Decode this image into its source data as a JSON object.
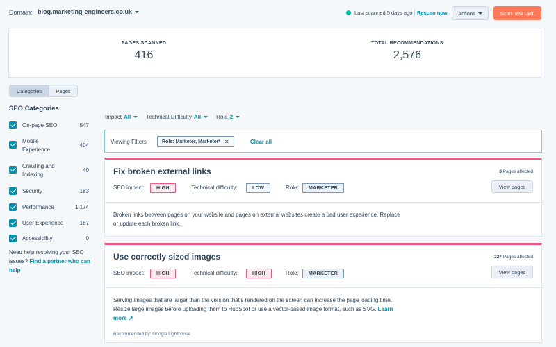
{
  "header": {
    "domain_label": "Domain:",
    "domain_value": "blog.marketing-engineers.co.uk",
    "last_scanned": "Last scanned 5 days ago",
    "rescan": "Rescan now",
    "actions": "Actions",
    "scan_new": "Scan new URL",
    "status_color": "#00bda5"
  },
  "stats": [
    {
      "label": "PAGES SCANNED",
      "value": "416"
    },
    {
      "label": "TOTAL RECOMMENDATIONS",
      "value": "2,576"
    }
  ],
  "view_toggle": {
    "categories": "Categories",
    "pages": "Pages"
  },
  "sidebar": {
    "title": "SEO Categories",
    "categories": [
      {
        "name": "On-page SEO",
        "count": "547",
        "checked": true
      },
      {
        "name": "Mobile Experience",
        "count": "404",
        "checked": true
      },
      {
        "name": "Crawling and Indexing",
        "count": "40",
        "checked": true
      },
      {
        "name": "Security",
        "count": "183",
        "checked": true
      },
      {
        "name": "Performance",
        "count": "1,174",
        "checked": true
      },
      {
        "name": "User Experience",
        "count": "167",
        "checked": true
      },
      {
        "name": "Accessibility",
        "count": "0",
        "checked": true
      }
    ],
    "help_text": "Need help resolving your SEO issues?",
    "help_link": "Find a partner who can help"
  },
  "filters": {
    "impact_label": "Impact",
    "impact_value": "All",
    "difficulty_label": "Technical Difficulty",
    "difficulty_value": "All",
    "role_label": "Role",
    "role_value": "2"
  },
  "viewing_filters": {
    "label": "Viewing Filters",
    "chip": "Role: Marketer, Marketer*",
    "clear": "Clear all"
  },
  "recommendations": [
    {
      "title": "Fix broken external links",
      "pages_count": "8",
      "pages_label": "Pages affected",
      "view_pages": "View pages",
      "seo_impact_label": "SEO impact:",
      "seo_impact": "HIGH",
      "difficulty_label": "Technical difficulty:",
      "difficulty": "LOW",
      "role_label": "Role:",
      "role": "MARKETER",
      "description": "Broken links between pages on your website and pages on external websites create a bad user experience. Replace or update each broken link."
    },
    {
      "title": "Use correctly sized images",
      "pages_count": "227",
      "pages_label": "Pages affected",
      "view_pages": "View pages",
      "seo_impact_label": "SEO impact:",
      "seo_impact": "HIGH",
      "difficulty_label": "Technical difficulty:",
      "difficulty": "HIGH",
      "role_label": "Role:",
      "role": "MARKETER",
      "description": "Serving images that are larger than the version that's rendered on the screen can increase the page loading time. Resize large images before uploading them to HubSpot or use a vector-based image format, such as SVG.",
      "learn_more": "Learn more",
      "recommended_by": "Recommended by: Google Lighthouse"
    }
  ],
  "colors": {
    "accent": "#0091ae",
    "primary": "#ff7a59",
    "card_top": "#f2547d"
  }
}
